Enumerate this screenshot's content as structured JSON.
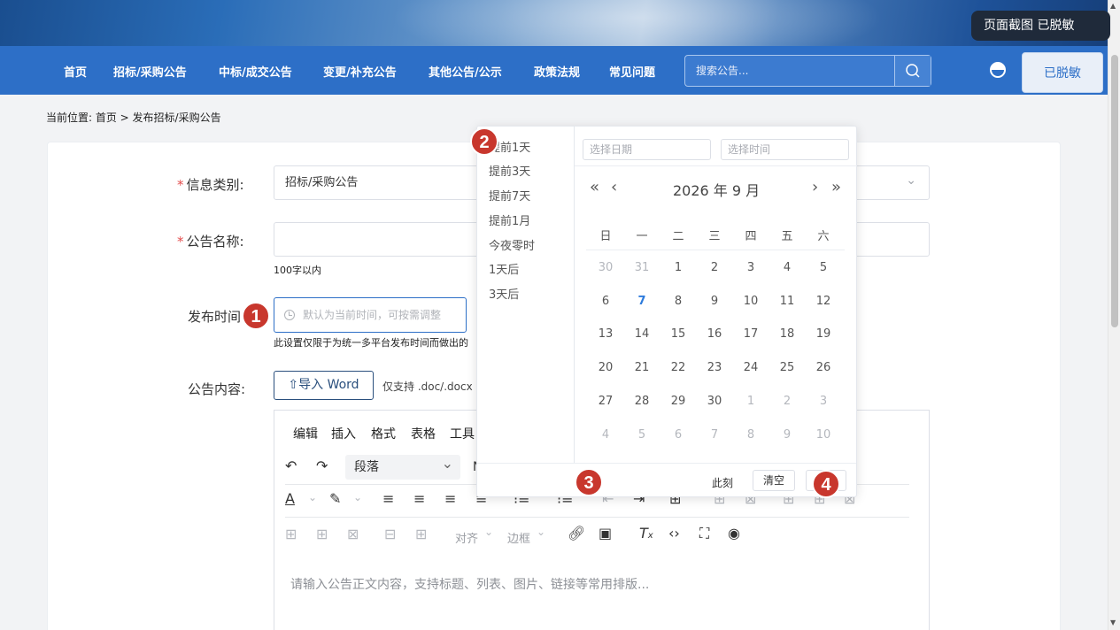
{
  "tooltip": {
    "text": "页面截图  已脱敏"
  },
  "nav": {
    "items": [
      "首页",
      "招标/采购公告",
      "中标/成交公告",
      "变更/补充公告",
      "其他公告/公示",
      "政策法规",
      "常见问题"
    ],
    "search_placeholder": "搜索公告...",
    "desensitize_label": "已脱敏"
  },
  "breadcrumb": {
    "text": "当前位置:  首页  >  发布招标/采购公告"
  },
  "form": {
    "category_label": "信息类别:",
    "category_value": "招标/采购公告",
    "name_label": "公告名称:",
    "name_hint": "100字以内",
    "time_label": "发布时间",
    "time_placeholder": "默认为当前时间，可按需调整",
    "time_hint": "此设置仅限于为统一多平台发布时间而做出的",
    "content_label": "公告内容:",
    "import_label": "⇧导入 Word",
    "import_hint": "仅支持 .doc/.docx 文"
  },
  "editor": {
    "menu": [
      "编辑",
      "插入",
      "格式",
      "表格",
      "工具"
    ],
    "paragraph_select": "段落",
    "align_label": "对齐",
    "border_label": "边框",
    "placeholder": "请输入公告正文内容，支持标题、列表、图片、链接等常用排版..."
  },
  "picker": {
    "shortcuts": [
      "提前1天",
      "提前3天",
      "提前7天",
      "提前1月",
      "今夜零时",
      "1天后",
      "3天后"
    ],
    "date_placeholder": "选择日期",
    "time_placeholder": "选择时间",
    "title": "2026 年  9 月",
    "weekdays": [
      "日",
      "一",
      "二",
      "三",
      "四",
      "五",
      "六"
    ],
    "weeks": [
      [
        {
          "d": "30",
          "o": 1
        },
        {
          "d": "31",
          "o": 1
        },
        {
          "d": "1"
        },
        {
          "d": "2"
        },
        {
          "d": "3"
        },
        {
          "d": "4"
        },
        {
          "d": "5"
        }
      ],
      [
        {
          "d": "6"
        },
        {
          "d": "7",
          "t": 1
        },
        {
          "d": "8"
        },
        {
          "d": "9"
        },
        {
          "d": "10"
        },
        {
          "d": "11"
        },
        {
          "d": "12"
        }
      ],
      [
        {
          "d": "13"
        },
        {
          "d": "14"
        },
        {
          "d": "15"
        },
        {
          "d": "16"
        },
        {
          "d": "17"
        },
        {
          "d": "18"
        },
        {
          "d": "19"
        }
      ],
      [
        {
          "d": "20"
        },
        {
          "d": "21"
        },
        {
          "d": "22"
        },
        {
          "d": "23"
        },
        {
          "d": "24"
        },
        {
          "d": "25"
        },
        {
          "d": "26"
        }
      ],
      [
        {
          "d": "27"
        },
        {
          "d": "28"
        },
        {
          "d": "29"
        },
        {
          "d": "30"
        },
        {
          "d": "1",
          "o": 1
        },
        {
          "d": "2",
          "o": 1
        },
        {
          "d": "3",
          "o": 1
        }
      ],
      [
        {
          "d": "4",
          "o": 1
        },
        {
          "d": "5",
          "o": 1
        },
        {
          "d": "6",
          "o": 1
        },
        {
          "d": "7",
          "o": 1
        },
        {
          "d": "8",
          "o": 1
        },
        {
          "d": "9",
          "o": 1
        },
        {
          "d": "10",
          "o": 1
        }
      ]
    ],
    "now_label": "此刻",
    "clear_label": "清空"
  },
  "badges": [
    "1",
    "2",
    "3",
    "4"
  ],
  "colors": {
    "nav_bg": "#2d6fc7",
    "badge": "#c8372d",
    "today": "#2d7bdc"
  }
}
